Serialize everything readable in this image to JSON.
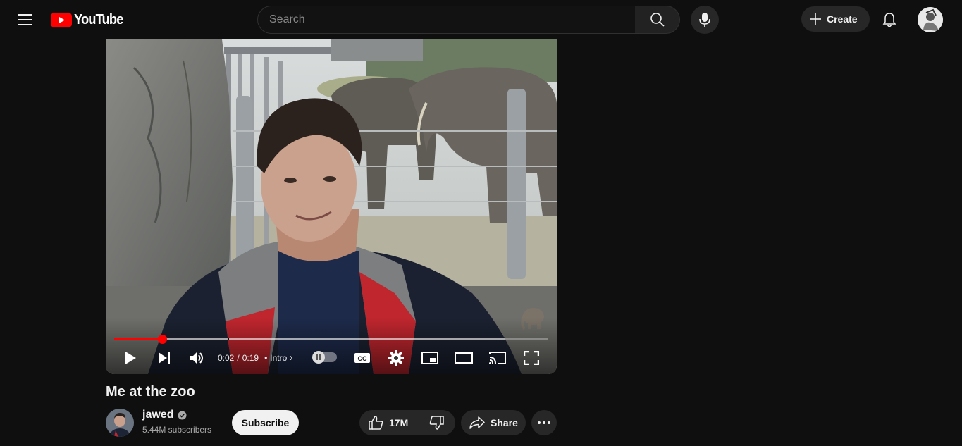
{
  "masthead": {
    "logo_text": "YouTube",
    "search_placeholder": "Search",
    "create_label": "Create"
  },
  "player": {
    "current_time": "0:02",
    "separator": "/",
    "duration": "0:19",
    "chapter_dot": "•",
    "chapter": "Intro",
    "chapter_arrow": "›",
    "progress_played_fraction": 0.11,
    "progress_loaded_fraction": 0.9,
    "icons": [
      "play-icon",
      "next-icon",
      "volume-icon",
      "autoplay-toggle",
      "captions-icon",
      "settings-icon",
      "miniplayer-icon",
      "theater-icon",
      "cast-icon",
      "fullscreen-icon"
    ]
  },
  "video": {
    "title": "Me at the zoo",
    "channel_name": "jawed",
    "subscribers": "5.44M subscribers",
    "subscribe_label": "Subscribe",
    "like_count": "17M",
    "share_label": "Share"
  },
  "colors": {
    "background": "#0f0f0f",
    "brand_red": "#ff0000",
    "button_bg": "#272727"
  }
}
